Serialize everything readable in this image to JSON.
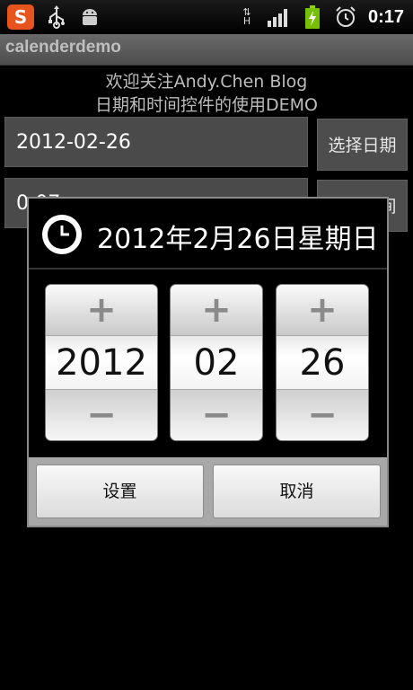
{
  "status_bar": {
    "app_badge": "S",
    "time": "0:17",
    "network_type": "H",
    "icons": [
      "sogou-input-icon",
      "usb-icon",
      "android-debug-icon",
      "data-transfer-icon",
      "signal-icon",
      "battery-charging-icon",
      "alarm-icon"
    ]
  },
  "title_bar": {
    "title": "calenderdemo"
  },
  "intro": {
    "line1": "欢迎关注Andy.Chen Blog",
    "line2": "日期和时间控件的使用DEMO"
  },
  "date_field": {
    "value": "2012-02-26"
  },
  "time_field": {
    "value": "0:07"
  },
  "buttons": {
    "pick_date": "选择日期",
    "pick_time": "选择时间"
  },
  "dialog": {
    "title": "2012年2月26日星期日",
    "year": "2012",
    "month": "02",
    "day": "26",
    "plus": "+",
    "minus": "−",
    "set_label": "设置",
    "cancel_label": "取消"
  },
  "colors": {
    "background": "#000000",
    "accent_battery": "#4caf00",
    "badge": "#e8541e"
  }
}
